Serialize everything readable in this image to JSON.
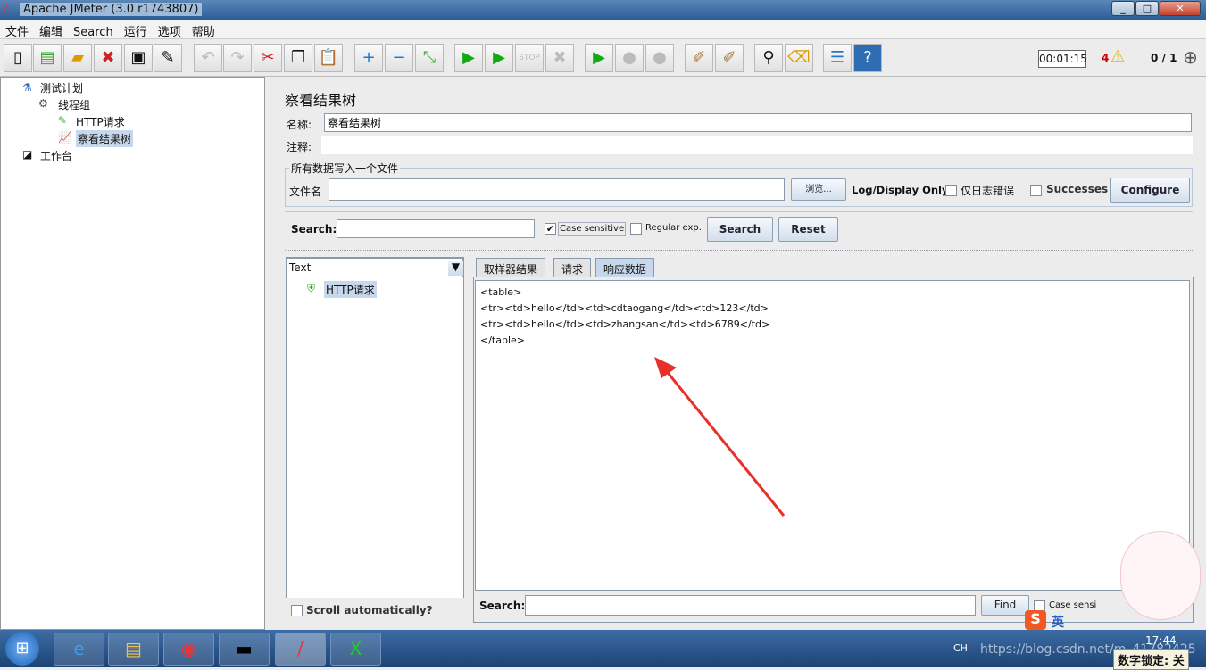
{
  "window": {
    "title": "Apache JMeter (3.0 r1743807)",
    "controls": [
      "_",
      "□",
      "✕"
    ]
  },
  "menu": [
    "文件",
    "编辑",
    "Search",
    "运行",
    "选项",
    "帮助"
  ],
  "toolbar": {
    "icons": [
      "new-icon",
      "templates-icon",
      "open-icon",
      "close-icon",
      "save-icon",
      "save-as-icon",
      "undo-icon",
      "redo-icon",
      "cut-icon",
      "copy-icon",
      "paste-icon",
      "expand-icon",
      "collapse-icon",
      "toggle-icon",
      "start-icon",
      "start-no-pause-icon",
      "stop-icon",
      "shutdown-icon",
      "remote-start-icon",
      "remote-stop-icon",
      "remote-shutdown-icon",
      "clear-icon",
      "clear-all-icon",
      "search-icon",
      "reset-search-icon",
      "function-helper-icon",
      "help-icon"
    ],
    "timer": "00:01:15",
    "warnings": "4",
    "threads": "0 / 1"
  },
  "tree": {
    "items": [
      "测试计划",
      "线程组",
      "HTTP请求",
      "察看结果树",
      "工作台"
    ]
  },
  "panel": {
    "title": "察看结果树",
    "name_label": "名称:",
    "name_value": "察看结果树",
    "comment_label": "注释:",
    "comment_value": "",
    "file_group": "所有数据写入一个文件",
    "file_label": "文件名",
    "file_value": "",
    "browse": "浏览...",
    "log_display": "Log/Display Only:",
    "errors_only": "仅日志错误",
    "successes": "Successes",
    "configure": "Configure"
  },
  "search": {
    "label": "Search:",
    "value": "",
    "case_sensitive": "Case sensitive",
    "case_checked": true,
    "regex": "Regular exp.",
    "regex_checked": false,
    "search_btn": "Search",
    "reset_btn": "Reset"
  },
  "results": {
    "renderer": "Text",
    "items": [
      "HTTP请求"
    ],
    "scroll_auto": "Scroll automatically?",
    "tabs": [
      "取样器结果",
      "请求",
      "响应数据"
    ],
    "active_tab": "响应数据",
    "response": [
      "<table>",
      "<tr><td>hello</td><td>cdtaogang</td><td>123</td>",
      "<tr><td>hello</td><td>zhangsan</td><td>6789</td>",
      "</table>"
    ],
    "bottom_search_label": "Search:",
    "bottom_search_value": "",
    "find": "Find",
    "case_sensitive": "Case sensi"
  },
  "taskbar": {
    "apps": [
      "start-icon",
      "ie-icon",
      "explorer-icon",
      "chrome-icon",
      "cmd-icon",
      "jmeter-icon",
      "xmanager-icon"
    ],
    "lang": "CH",
    "ime": "英",
    "clock": "17:44",
    "numlock": "数字锁定: 关",
    "watermark": "https://blog.csdn.net/m_41782425"
  },
  "colors": {
    "arrow": "#e8302a",
    "titlebar": "#2e5e96",
    "selection": "#c8d8ec"
  }
}
